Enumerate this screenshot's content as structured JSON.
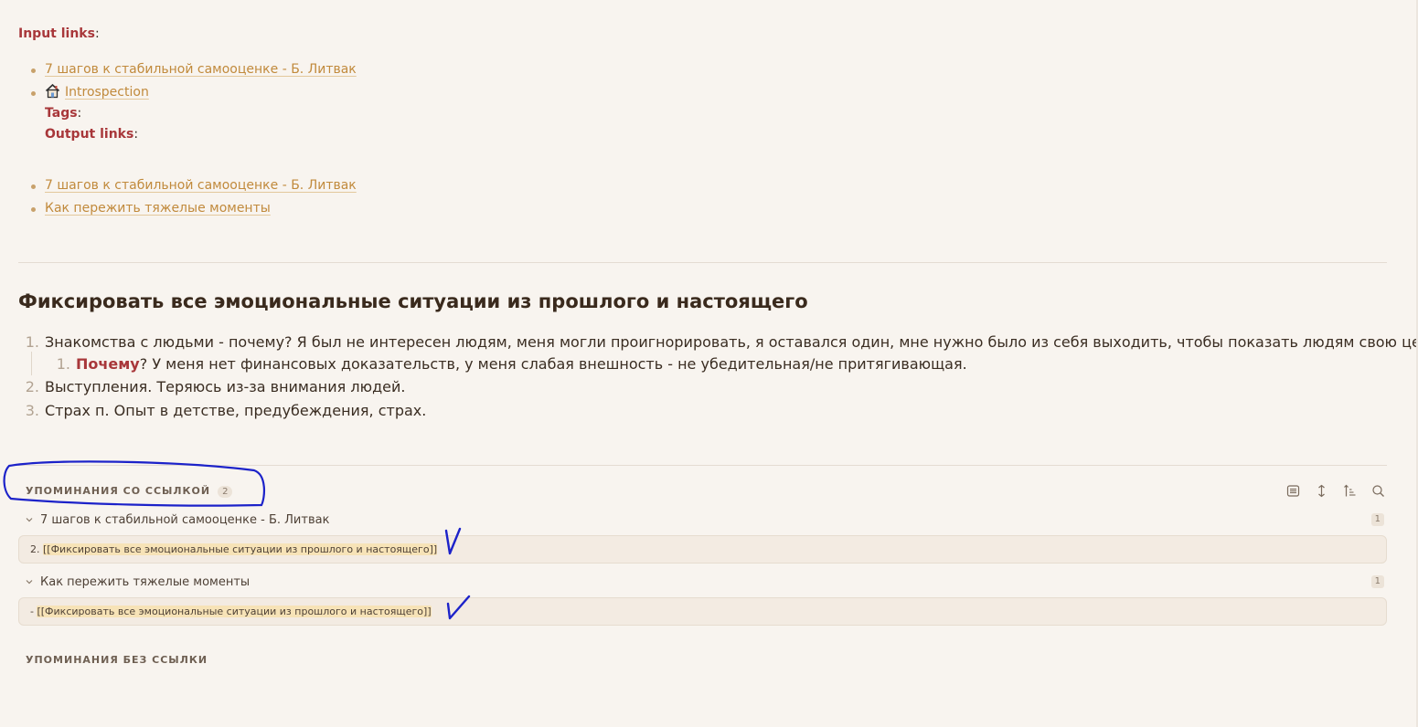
{
  "properties": {
    "input_links_label": "Input links",
    "input_links": [
      "7 шагов к стабильной самооценке - Б. Литвак",
      "Introspection"
    ],
    "tags_label": "Tags",
    "output_links_label": "Output links",
    "output_links": [
      "7 шагов к стабильной самооценке - Б. Литвак",
      "Как пережить тяжелые моменты"
    ],
    "colon": ":"
  },
  "note": {
    "heading": "Фиксировать все эмоциональные ситуации из прошлого и настоящего",
    "items": [
      {
        "num": "1.",
        "text": "Знакомства с людьми - почему? Я был не интересен людям, меня могли проигнорировать, я оставался один, мне нужно было из себя выходить, чтобы показать людям свою ценность?"
      },
      {
        "num": "1.",
        "keyword": "Почему",
        "text": "? У меня нет финансовых доказательств, у меня слабая внешность - не убедительная/не притягивающая."
      },
      {
        "num": "2.",
        "text": "Выступления. Теряюсь из-за внимания людей."
      },
      {
        "num": "3.",
        "text": "Страх п. Опыт в детстве, предубеждения, страх."
      }
    ]
  },
  "backlinks": {
    "linked_title": "УПОМИНАНИЯ СО ССЫЛКОЙ",
    "linked_count": "2",
    "groups": [
      {
        "title": "7 шагов к стабильной самооценке - Б. Литвак",
        "count": "1",
        "prefix": "2. ",
        "match": "[[Фиксировать все эмоциональные ситуации из прошлого и настоящего]]"
      },
      {
        "title": "Как пережить тяжелые моменты",
        "count": "1",
        "prefix": "- ",
        "match": "[[Фиксировать все эмоциональные ситуации из прошлого и настоящего]]"
      }
    ],
    "unlinked_title": "УПОМИНАНИЯ БЕЗ ССЫЛКИ"
  },
  "icons": {
    "introspection_icon": "house-icon",
    "toolbar": [
      "collapse-results-icon",
      "expand-context-icon",
      "sort-icon",
      "search-icon"
    ]
  },
  "colors": {
    "background": "#f8f4ef",
    "property_label": "#a8373a",
    "link": "#c18a3c",
    "annotation_ink": "#1c22c9"
  }
}
